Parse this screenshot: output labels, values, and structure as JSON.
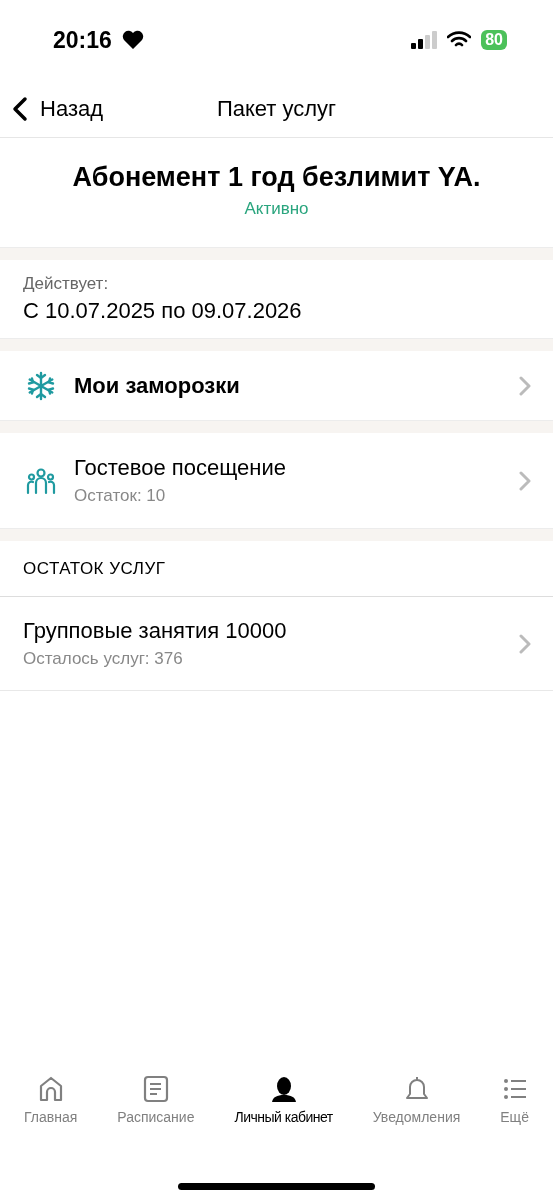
{
  "status_bar": {
    "time": "20:16",
    "battery": "80"
  },
  "nav": {
    "back": "Назад",
    "title": "Пакет услуг"
  },
  "subscription": {
    "name": "Абонемент 1 год безлимит YA.",
    "status": "Активно"
  },
  "validity": {
    "label": "Действует:",
    "period": "С 10.07.2025 по 09.07.2026"
  },
  "menu": [
    {
      "kind": "freeze",
      "title": "Мои заморозки"
    },
    {
      "kind": "guest",
      "title": "Гостевое посещение",
      "subtitle": "Остаток: 10"
    }
  ],
  "services": {
    "heading": "ОСТАТОК УСЛУГ",
    "items": [
      {
        "title": "Групповые занятия 10000",
        "subtitle": "Осталось услуг: 376"
      }
    ]
  },
  "tab_bar": [
    {
      "kind": "home",
      "label": "Главная",
      "selected": false
    },
    {
      "kind": "schedule",
      "label": "Расписание",
      "selected": false
    },
    {
      "kind": "profile",
      "label": "Личный кабинет",
      "selected": true
    },
    {
      "kind": "notifications",
      "label": "Уведомления",
      "selected": false
    },
    {
      "kind": "more",
      "label": "Ещё",
      "selected": false
    }
  ]
}
